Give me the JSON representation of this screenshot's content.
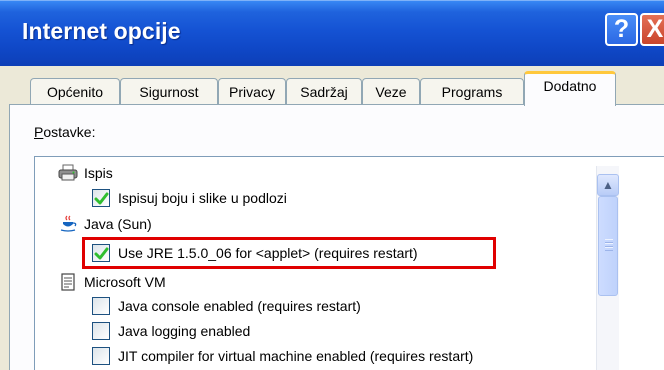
{
  "window": {
    "title": "Internet opcije",
    "help_label": "?",
    "close_label": "X",
    "colors": {
      "titlebar": "#0f47c6",
      "active_tab_accent": "#ffc83c",
      "highlight": "#e00000",
      "checkmark": "#2fbe2f"
    }
  },
  "tabs": [
    {
      "label": "Općenito",
      "active": false
    },
    {
      "label": "Sigurnost",
      "active": false
    },
    {
      "label": "Privacy",
      "active": false
    },
    {
      "label": "Sadržaj",
      "active": false
    },
    {
      "label": "Veze",
      "active": false
    },
    {
      "label": "Programs",
      "active": false
    },
    {
      "label": "Dodatno",
      "active": true
    }
  ],
  "section": {
    "label": "Postavke:",
    "label_first_char": "P",
    "label_rest": "ostavke:"
  },
  "settings": [
    {
      "type": "category",
      "label": "Ispis",
      "icon": "printer-icon"
    },
    {
      "type": "option",
      "label": "Ispisuj boju i slike u podlozi",
      "checked": true
    },
    {
      "type": "category",
      "label": "Java (Sun)",
      "icon": "java-icon"
    },
    {
      "type": "option",
      "label": "Use JRE 1.5.0_06 for <applet> (requires restart)",
      "checked": true,
      "highlighted": true
    },
    {
      "type": "category",
      "label": "Microsoft VM",
      "icon": "document-icon"
    },
    {
      "type": "option",
      "label": "Java console enabled (requires restart)",
      "checked": false
    },
    {
      "type": "option",
      "label": "Java logging enabled",
      "checked": false
    },
    {
      "type": "option",
      "label": "JIT compiler for virtual machine enabled (requires restart)",
      "checked": false
    }
  ],
  "scrollbar": {
    "up_arrow_icon": "chevron-up-icon"
  }
}
